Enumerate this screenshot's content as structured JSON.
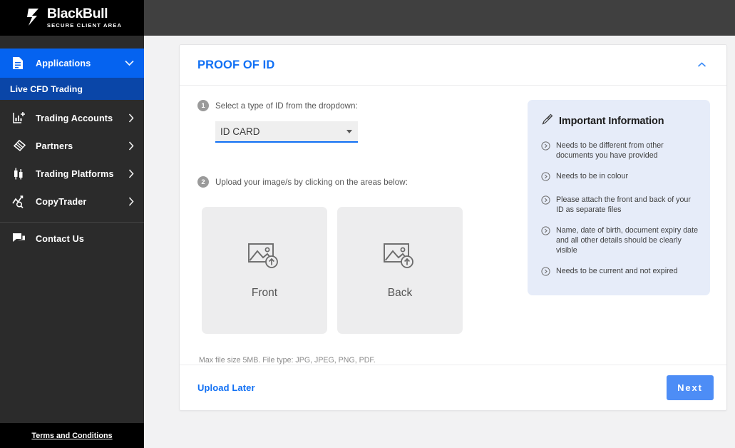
{
  "brand": {
    "name": "BlackBull",
    "tagline": "SECURE CLIENT AREA",
    "logo_icon": "blackbull-logo-icon"
  },
  "sidebar": {
    "active_item": {
      "label": "Applications",
      "icon": "document-icon",
      "chevron": "chevron-down-icon",
      "background": "#0563f0"
    },
    "sub_item": {
      "label": "Live CFD Trading",
      "background": "#0a46a8"
    },
    "items": [
      {
        "label": "Trading Accounts",
        "icon": "bar-chart-plus-icon",
        "chevron": "chevron-right-icon"
      },
      {
        "label": "Partners",
        "icon": "handshake-icon",
        "chevron": "chevron-right-icon"
      },
      {
        "label": "Trading Platforms",
        "icon": "candlestick-icon",
        "chevron": "chevron-right-icon"
      },
      {
        "label": "CopyTrader",
        "icon": "chart-search-icon",
        "chevron": "chevron-right-icon"
      }
    ],
    "contact": {
      "label": "Contact Us",
      "icon": "chat-bubbles-icon"
    },
    "footer_link": "Terms and Conditions"
  },
  "card": {
    "title": "PROOF OF ID",
    "collapse_icon": "chevron-up-icon",
    "title_color": "#1170f4"
  },
  "steps": [
    {
      "number": "1",
      "label": "Select a type of ID from the dropdown:"
    },
    {
      "number": "2",
      "label": "Upload your image/s by clicking on the areas below:"
    }
  ],
  "id_type_select": {
    "value": "ID CARD",
    "caret_icon": "caret-down-icon",
    "underline_color": "#1170f4"
  },
  "uploads": [
    {
      "label": "Front",
      "icon": "image-upload-icon"
    },
    {
      "label": "Back",
      "icon": "image-upload-icon"
    }
  ],
  "file_note": "Max file size 5MB. File type: JPG, JPEG, PNG, PDF.",
  "info_panel": {
    "icon": "pen-writing-icon",
    "title": "Important Information",
    "background": "#e6ecf9",
    "bullet_icon": "circle-chevron-right-icon",
    "items": [
      "Needs to be different from other documents you have provided",
      "Needs to be in colour",
      "Please attach the front and back of your ID as separate files",
      "Name, date of birth, document expiry date and all other details should be clearly visible",
      "Needs to be current and not expired"
    ]
  },
  "footer": {
    "upload_later_label": "Upload Later",
    "next_label": "Next",
    "next_color": "#4d8df6"
  }
}
